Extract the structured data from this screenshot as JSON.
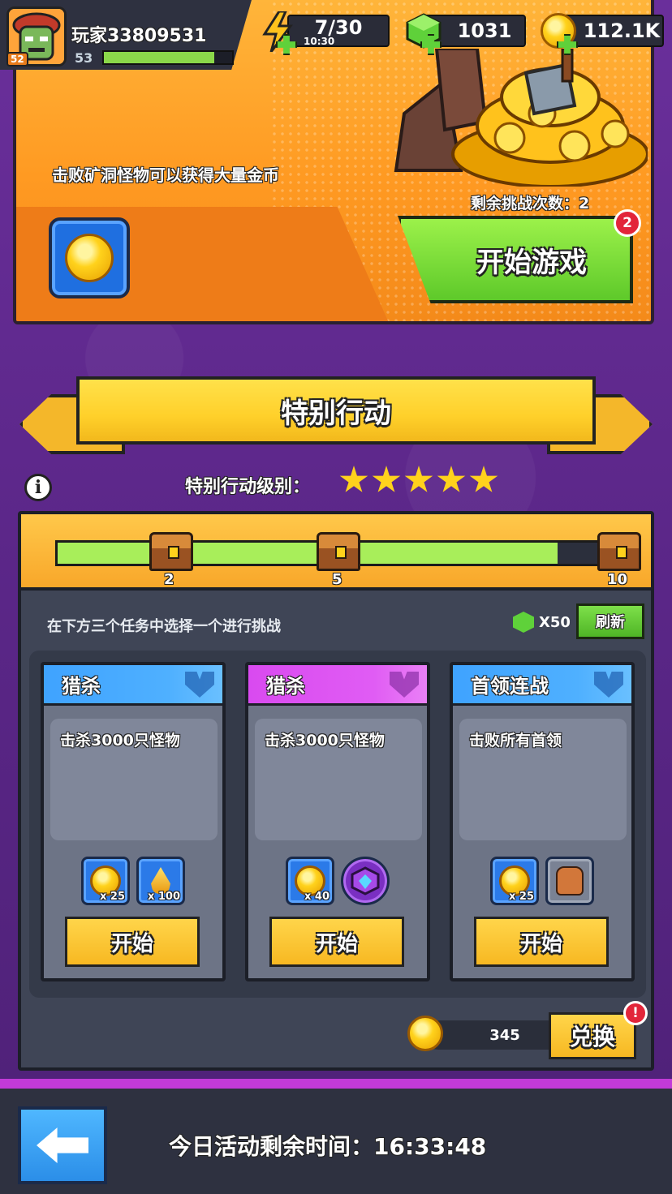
{
  "player": {
    "name": "玩家33809531",
    "avatar_level": "52",
    "level": "53",
    "xp_fraction": 0.86
  },
  "resources": {
    "energy": "7/30",
    "energy_timer": "10:30",
    "gems": "1031",
    "gold": "112.1K"
  },
  "banner": {
    "description": "击败矿洞怪物可以获得大量金币",
    "remaining_label": "剩余挑战次数：2",
    "start_label": "开始游戏",
    "start_badge": "2"
  },
  "special": {
    "title": "特别行动",
    "level_label": "特别行动级别：",
    "stars": 5,
    "info_glyph": "i"
  },
  "progress": {
    "fraction": 0.9,
    "milestones": [
      "2",
      "5",
      "10"
    ]
  },
  "tasks": {
    "hint": "在下方三个任务中选择一个进行挑战",
    "refresh_cost": "X50",
    "refresh_label": "刷新",
    "cards": [
      {
        "type": "猎杀",
        "color": "#3fa3ff",
        "description": "击杀3000只怪物",
        "rewards": [
          "x 25",
          "x 100"
        ],
        "start_label": "开始"
      },
      {
        "type": "猎杀",
        "color": "#d94af0",
        "description": "击杀3000只怪物",
        "rewards": [
          "x 40",
          ""
        ],
        "start_label": "开始"
      },
      {
        "type": "首领连战",
        "color": "#3fa3ff",
        "description": "击败所有首领",
        "rewards": [
          "x 25",
          ""
        ],
        "start_label": "开始"
      }
    ]
  },
  "exchange": {
    "tokens": "345",
    "label": "兑换",
    "badge": "!"
  },
  "footer": {
    "timer_label": "今日活动剩余时间：16:33:48"
  }
}
